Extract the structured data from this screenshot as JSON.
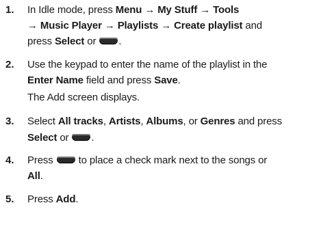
{
  "steps": [
    {
      "number": "1.",
      "lines": [
        [
          {
            "t": "In Idle mode, press ",
            "b": false
          },
          {
            "t": "Menu",
            "b": true
          },
          {
            "t": " → ",
            "b": false
          },
          {
            "t": "My Stuff",
            "b": true
          },
          {
            "t": " → ",
            "b": false
          },
          {
            "t": "Tools",
            "b": true
          }
        ],
        [
          {
            "t": "→ ",
            "b": false
          },
          {
            "t": "Music Player",
            "b": true
          },
          {
            "t": " → ",
            "b": false
          },
          {
            "t": "Playlists",
            "b": true
          },
          {
            "t": " → ",
            "b": false
          },
          {
            "t": "Create playlist",
            "b": true
          },
          {
            "t": " and",
            "b": false
          }
        ],
        [
          {
            "t": "press ",
            "b": false
          },
          {
            "t": "Select",
            "b": true
          },
          {
            "t": " or ",
            "b": false
          },
          {
            "icon": "select-key-icon"
          },
          {
            "t": ".",
            "b": false
          }
        ]
      ]
    },
    {
      "number": "2.",
      "lines": [
        [
          {
            "t": "Use the keypad to enter the name of the playlist in the",
            "b": false
          }
        ],
        [
          {
            "t": "Enter Name",
            "b": true
          },
          {
            "t": " field and press ",
            "b": false
          },
          {
            "t": "Save",
            "b": true
          },
          {
            "t": ".",
            "b": false
          }
        ],
        [
          {
            "t": "The Add screen displays.",
            "b": false
          }
        ]
      ]
    },
    {
      "number": "3.",
      "lines": [
        [
          {
            "t": "Select ",
            "b": false
          },
          {
            "t": "All tracks",
            "b": true
          },
          {
            "t": ", ",
            "b": false
          },
          {
            "t": "Artists",
            "b": true
          },
          {
            "t": ", ",
            "b": false
          },
          {
            "t": "Albums",
            "b": true
          },
          {
            "t": ", or ",
            "b": false
          },
          {
            "t": "Genres",
            "b": true
          },
          {
            "t": " and press",
            "b": false
          }
        ],
        [
          {
            "t": "Select",
            "b": true
          },
          {
            "t": " or ",
            "b": false
          },
          {
            "icon": "select-key-icon"
          },
          {
            "t": ".",
            "b": false
          }
        ]
      ]
    },
    {
      "number": "4.",
      "lines": [
        [
          {
            "t": "Press ",
            "b": false
          },
          {
            "icon": "select-key-icon"
          },
          {
            "t": " to place a check mark next to the songs or",
            "b": false
          }
        ],
        [
          {
            "t": "All",
            "b": true
          },
          {
            "t": ".",
            "b": false
          }
        ]
      ]
    },
    {
      "number": "5.",
      "lines": [
        [
          {
            "t": "Press ",
            "b": false
          },
          {
            "t": "Add",
            "b": true
          },
          {
            "t": ".",
            "b": false
          }
        ]
      ]
    }
  ]
}
